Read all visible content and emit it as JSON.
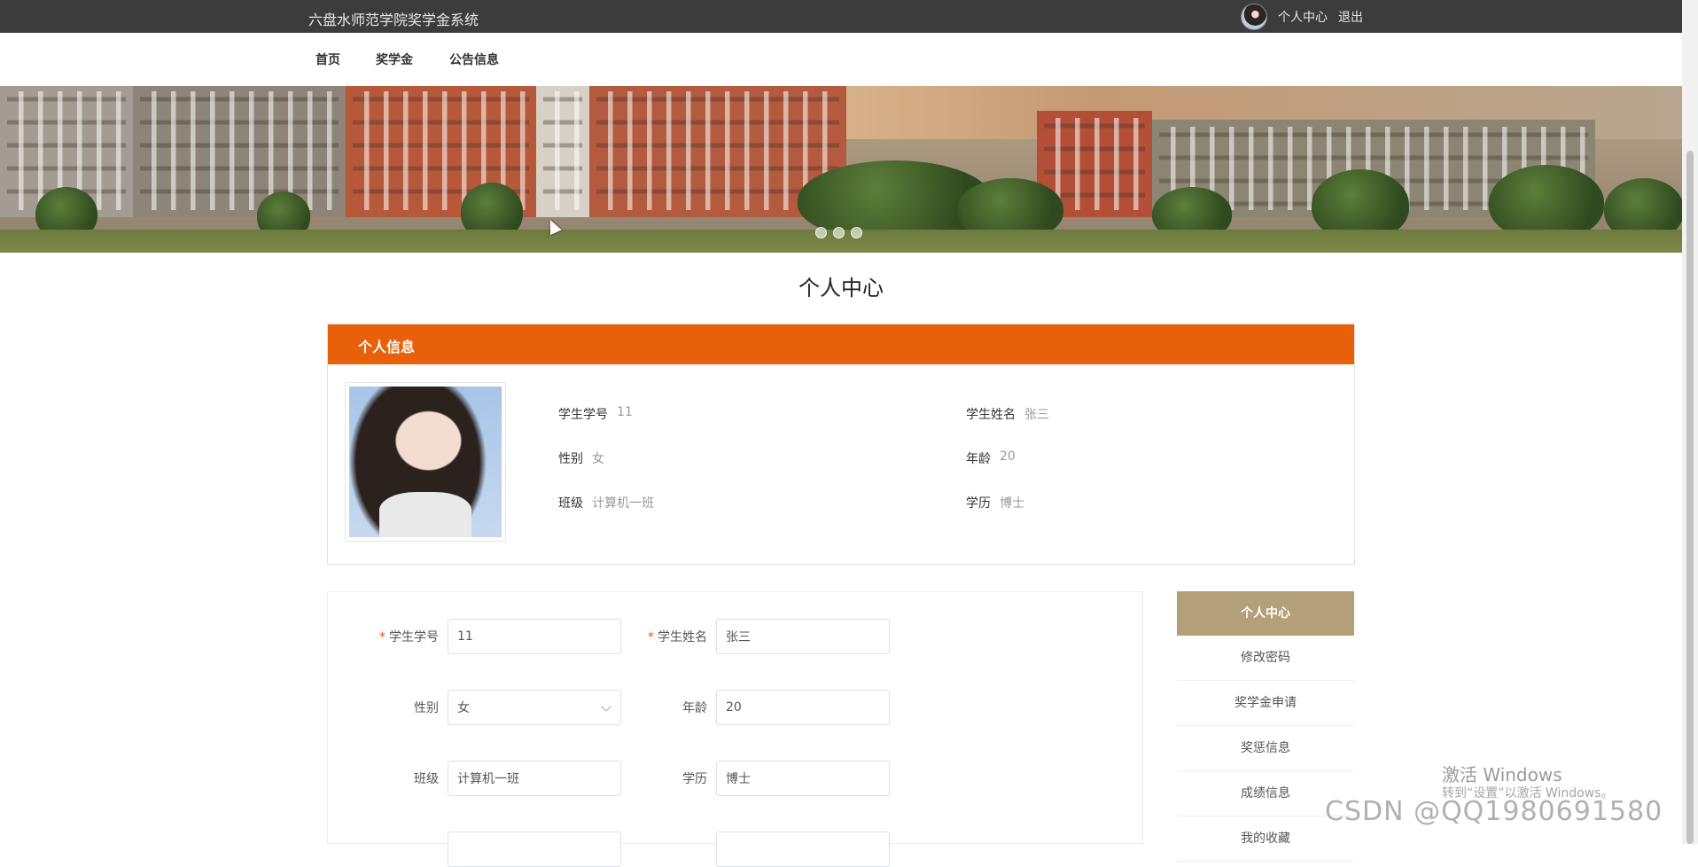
{
  "topbar": {
    "site_title": "六盘水师范学院奖学金系统",
    "personal_center": "个人中心",
    "logout": "退出"
  },
  "nav": [
    "首页",
    "奖学金",
    "公告信息"
  ],
  "banner": {
    "slides": 3
  },
  "page_title": "个人中心",
  "info_panel": {
    "heading": "个人信息",
    "header_color": "#e8600a",
    "fields": [
      {
        "label": "学生学号",
        "value": "11"
      },
      {
        "label": "学生姓名",
        "value": "张三"
      },
      {
        "label": "性别",
        "value": "女"
      },
      {
        "label": "年龄",
        "value": "20"
      },
      {
        "label": "班级",
        "value": "计算机一班"
      },
      {
        "label": "学历",
        "value": "博士"
      }
    ]
  },
  "form": {
    "fields": [
      {
        "label": "学生学号",
        "value": "11",
        "required": true
      },
      {
        "label": "学生姓名",
        "value": "张三",
        "required": true
      },
      {
        "label": "性别",
        "value": "女",
        "type": "select"
      },
      {
        "label": "年龄",
        "value": "20"
      },
      {
        "label": "班级",
        "value": "计算机一班"
      },
      {
        "label": "学历",
        "value": "博士"
      }
    ]
  },
  "side_menu": {
    "active": "个人中心",
    "active_color": "#b39f78",
    "items": [
      "修改密码",
      "奖学金申请",
      "奖惩信息",
      "成绩信息",
      "我的收藏"
    ]
  },
  "watermarks": {
    "activate_title": "激活 Windows",
    "activate_sub": "转到“设置”以激活 Windows。",
    "csdn": "CSDN @QQ1980691580"
  }
}
